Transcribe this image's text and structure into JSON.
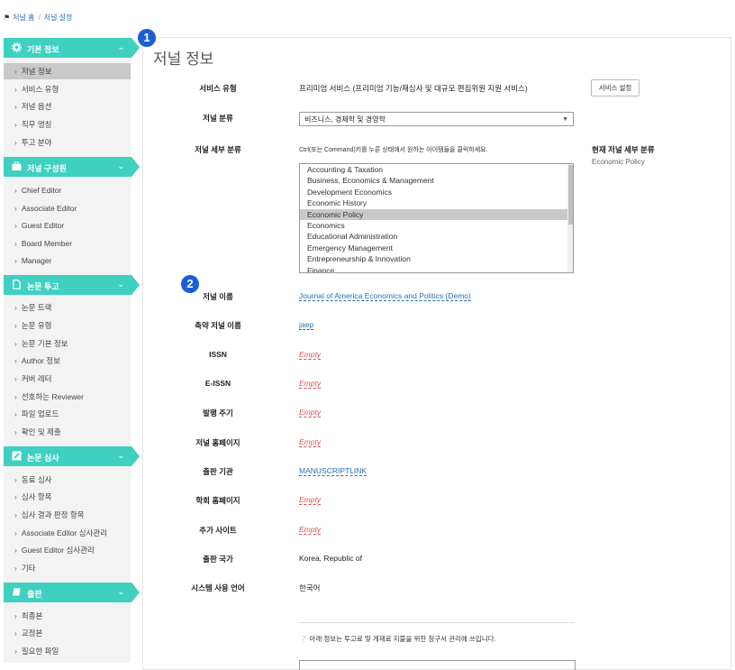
{
  "breadcrumb": {
    "home": "저널 홈",
    "separator": "/",
    "current": "저널 설정"
  },
  "sidebar": {
    "sections": [
      {
        "label": "기본 정보",
        "icon": "gear-icon",
        "items": [
          "저널 정보",
          "서비스 유형",
          "저널 옵션",
          "직무 명칭",
          "투고 분야"
        ]
      },
      {
        "label": "저널 구성원",
        "icon": "briefcase-icon",
        "items": [
          "Chief Editor",
          "Associate Editor",
          "Guest Editor",
          "Board Member",
          "Manager"
        ]
      },
      {
        "label": "논문 투고",
        "icon": "document-icon",
        "items": [
          "논문 트랙",
          "논문 유형",
          "논문 기본 정보",
          "Author 정보",
          "커버 레터",
          "선호하는 Reviewer",
          "파일 업로드",
          "확인 및 제출"
        ]
      },
      {
        "label": "논문 심사",
        "icon": "edit-icon",
        "items": [
          "동료 심사",
          "심사 항목",
          "심사 결과 판정 항목",
          "Associate Editor 심사관리",
          "Guest Editor 심사관리",
          "기타"
        ]
      },
      {
        "label": "출판",
        "icon": "book-icon",
        "items": [
          "최종본",
          "교정본",
          "필요한 파일"
        ]
      }
    ],
    "active_item": "저널 정보"
  },
  "main": {
    "title": "저널 정보",
    "badges": [
      "1",
      "2"
    ],
    "service_type": {
      "label": "서비스 유형",
      "value": "프리미엄 서비스 (프리미엄 기능/재심사 및 대규모 편집위원 지원 서비스)",
      "button": "서비스 설정"
    },
    "category": {
      "label": "저널 분류",
      "selected": "비즈니스, 경제학 및 경영학"
    },
    "subcategory": {
      "label": "저널 세부 분류",
      "hint": "Ctrl(또는 Command)키를 누른 상태에서 원하는 아이템들을 클릭하세요.",
      "options": [
        "Accounting & Taxation",
        "Business, Economics & Management",
        "Development Economics",
        "Economic History",
        "Economic Policy",
        "Economics",
        "Educational Administration",
        "Emergency Management",
        "Entrepreneurship & Innovation",
        "Finance"
      ],
      "selected": "Economic Policy",
      "current_title": "현재 저널 세부 분류",
      "current_value": "Economic Policy"
    },
    "fields": [
      {
        "label": "저널 이름",
        "value": "Journal of America Economics and Politics (Demo)",
        "kind": "link"
      },
      {
        "label": "축약 저널 이름",
        "value": "jaep",
        "kind": "link"
      },
      {
        "label": "ISSN",
        "value": "Empty",
        "kind": "empty"
      },
      {
        "label": "E-ISSN",
        "value": "Empty",
        "kind": "empty"
      },
      {
        "label": "발행 주기",
        "value": "Empty",
        "kind": "empty"
      },
      {
        "label": "저널 홈페이지",
        "value": "Empty",
        "kind": "empty"
      },
      {
        "label": "출판 기관",
        "value": "MANUSCRIPTLINK",
        "kind": "link"
      },
      {
        "label": "학회 홈페이지",
        "value": "Empty",
        "kind": "empty"
      },
      {
        "label": "추가 사이트",
        "value": "Empty",
        "kind": "empty"
      },
      {
        "label": "출판 국가",
        "value": "Korea, Republic of",
        "kind": "text"
      },
      {
        "label": "시스템 사용 언어",
        "value": "한국어",
        "kind": "text"
      }
    ],
    "notice": "아래 정보는 투고료 및 게재료 지불을 위한 청구서 관리에 쓰입니다."
  },
  "colors": {
    "accent": "#3fd0c0",
    "badge": "#1a5fd6",
    "link": "#2a6db0",
    "empty": "#d9534f"
  }
}
